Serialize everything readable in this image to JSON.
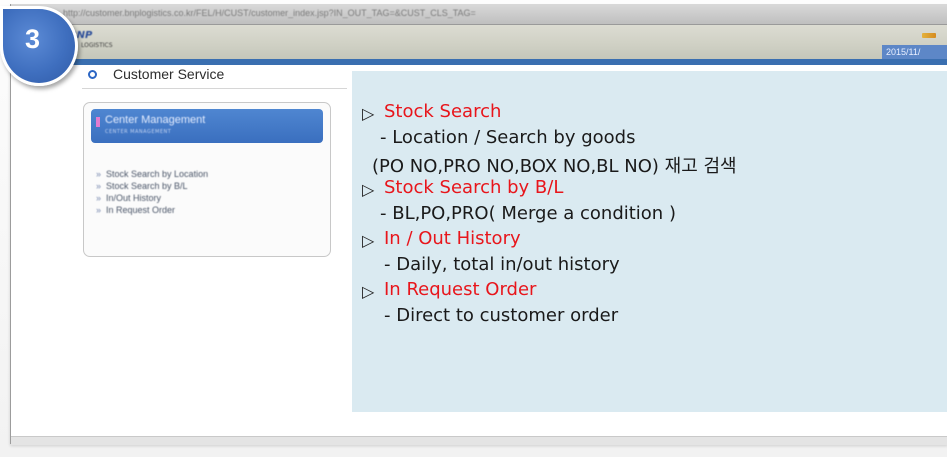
{
  "browser": {
    "url": "http://customer.bnplogistics.co.kr/FEL/H/CUST/customer_index.jsp?IN_OUT_TAG=&CUST_CLS_TAG="
  },
  "app": {
    "date": "2015/11/"
  },
  "step": {
    "number": "3"
  },
  "section": {
    "title": "Customer Service"
  },
  "sidebar": {
    "header_title": "Center Management",
    "header_subtitle": "CENTER MANAGEMENT",
    "items": [
      {
        "label": "Stock Search by Location"
      },
      {
        "label": "Stock Search by B/L"
      },
      {
        "label": "In/Out History"
      },
      {
        "label": "In Request Order"
      }
    ]
  },
  "info": {
    "bullet_symbol": "▷",
    "entries": [
      {
        "heading": "Stock Search",
        "lines": [
          "- Location / Search by goods",
          "(PO NO,PRO NO,BOX NO,BL NO) 재고 검색"
        ]
      },
      {
        "heading": "Stock Search by B/L",
        "lines": [
          "- BL,PO,PRO( Merge a condition )"
        ]
      },
      {
        "heading": "In / Out History",
        "lines": [
          "- Daily, total in/out history"
        ]
      },
      {
        "heading": "In Request Order",
        "lines": [
          "- Direct to customer order"
        ]
      }
    ]
  },
  "colors": {
    "heading_red": "#e8151b",
    "panel_bg": "#daeaf1",
    "badge_blue": "#3f6fbf"
  },
  "icons": {
    "section_bullet": "radio-bullet-icon",
    "menu_arrow": "double-arrow-icon",
    "heading_bullet": "triangle-right-icon"
  }
}
